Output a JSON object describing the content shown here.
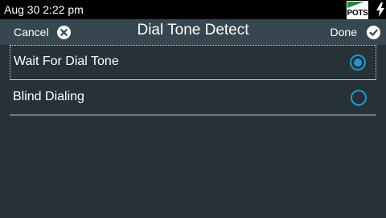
{
  "status_bar": {
    "datetime": "Aug 30 2:22 pm",
    "network_label": "POTS",
    "network_flag_color": "#1b8a3c",
    "icons": [
      "pots-network-icon",
      "power-bolt-icon"
    ]
  },
  "header": {
    "cancel_label": "Cancel",
    "title": "Dial Tone Detect",
    "done_label": "Done",
    "icons": [
      "cancel-x-circle-icon",
      "done-check-circle-icon"
    ]
  },
  "options": [
    {
      "label": "Wait For Dial Tone",
      "selected": true,
      "focused": true
    },
    {
      "label": "Blind Dialing",
      "selected": false,
      "focused": false
    }
  ],
  "colors": {
    "background": "#263238",
    "header_background": "#37474f",
    "status_background": "#000000",
    "radio_accent": "#2196d3"
  }
}
